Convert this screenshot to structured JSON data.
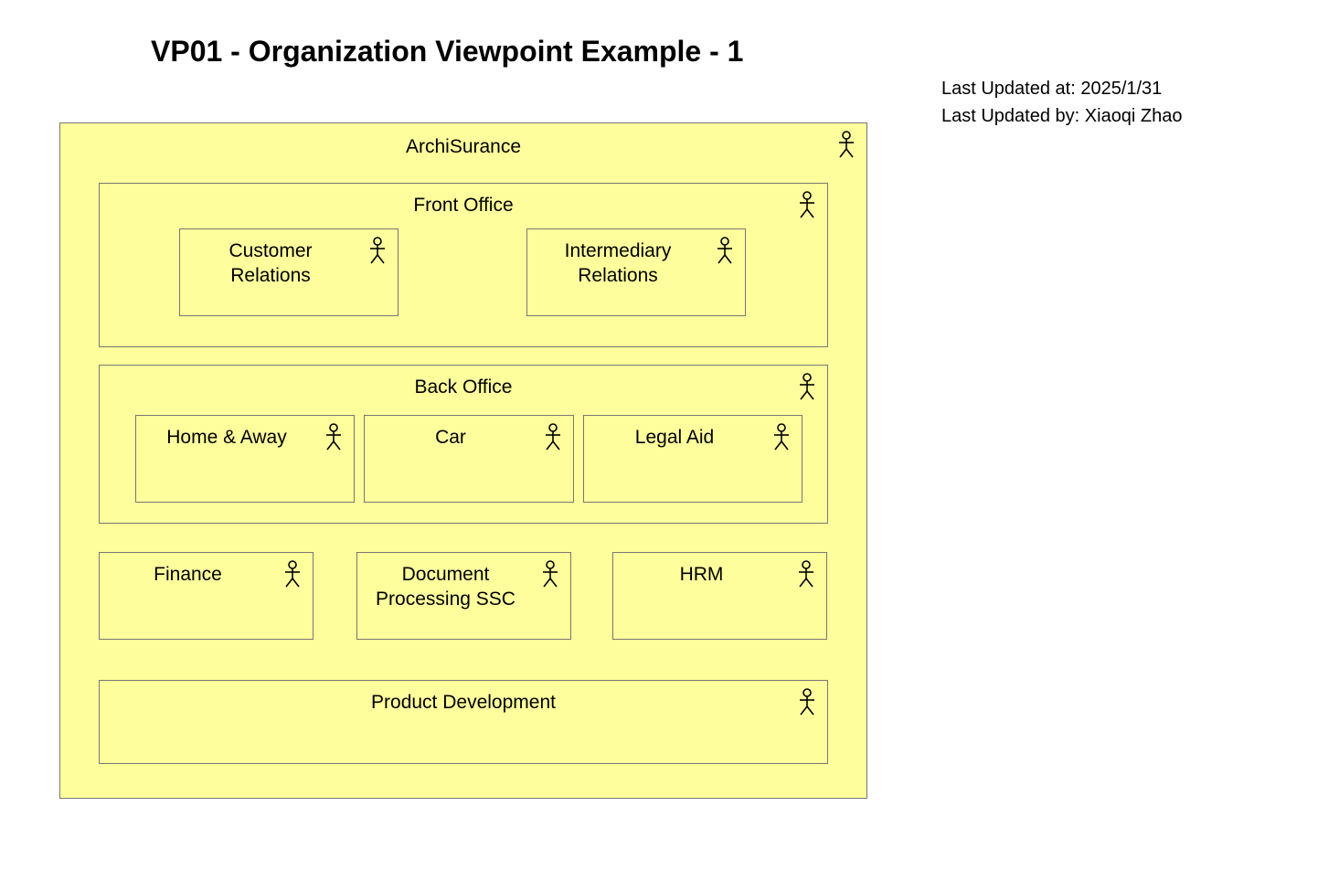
{
  "title": "VP01 - Organization Viewpoint Example - 1",
  "meta": {
    "updated_at_label": "Last Updated at: ",
    "updated_at_value": "2025/1/31",
    "updated_by_label": "Last Updated by: ",
    "updated_by_value": "Xiaoqi Zhao"
  },
  "archisurance": {
    "label": "ArchiSurance"
  },
  "front_office": {
    "label": "Front Office"
  },
  "customer_relations": {
    "label": "Customer\nRelations"
  },
  "intermediary_relations": {
    "label": "Intermediary\nRelations"
  },
  "back_office": {
    "label": "Back Office"
  },
  "home_away": {
    "label": "Home & Away"
  },
  "car": {
    "label": "Car"
  },
  "legal_aid": {
    "label": "Legal Aid"
  },
  "finance": {
    "label": "Finance"
  },
  "document_processing": {
    "label": "Document\nProcessing SSC"
  },
  "hrm": {
    "label": "HRM"
  },
  "product_development": {
    "label": "Product Development"
  }
}
